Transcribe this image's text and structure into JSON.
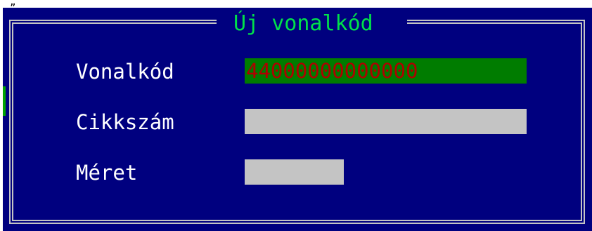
{
  "top_fragment": "„",
  "dialog": {
    "title": " Új vonalkód "
  },
  "fields": {
    "barcode": {
      "label": "Vonalkód",
      "value": "44000000000000"
    },
    "article_number": {
      "label": "Cikkszám",
      "value": ""
    },
    "size": {
      "label": "Méret",
      "value": ""
    }
  },
  "colors": {
    "dialog_background": "#00007f",
    "frame": "#c4c4c4",
    "title_text": "#00e04a",
    "label_text": "#ffffff",
    "active_field_background": "#007c00",
    "active_field_text": "#b00000",
    "inactive_field_background": "#c4c4c4"
  }
}
